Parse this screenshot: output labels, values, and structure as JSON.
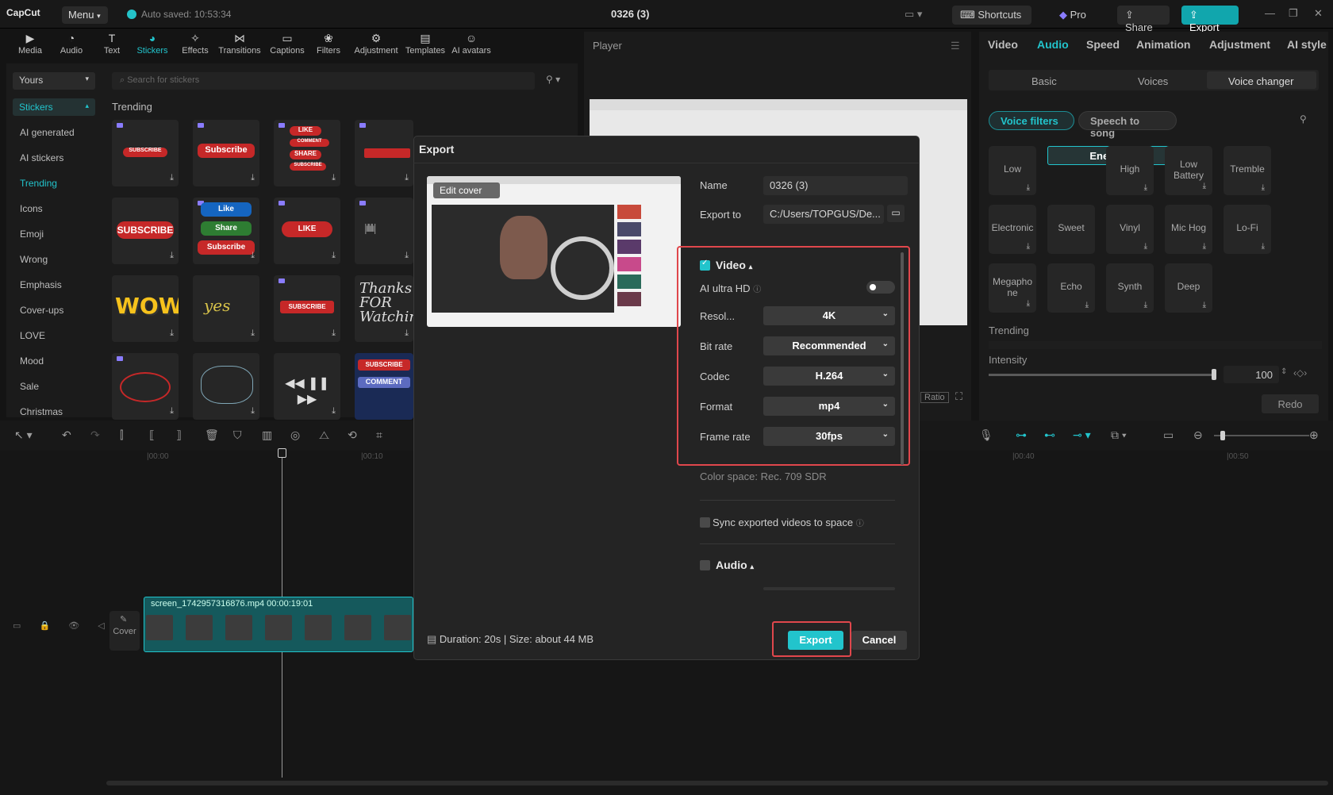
{
  "app": {
    "logo": "CapCut",
    "menu": "Menu",
    "autosaved": "Auto saved: 10:53:34",
    "title": "0326 (3)"
  },
  "topbar": {
    "shortcuts": "Shortcuts",
    "pro": "Pro",
    "share": "Share",
    "export": "Export"
  },
  "tools": [
    "Media",
    "Audio",
    "Text",
    "Stickers",
    "Effects",
    "Transitions",
    "Captions",
    "Filters",
    "Adjustment",
    "Templates",
    "AI avatars"
  ],
  "left": {
    "yours": "Yours",
    "search_placeholder": "Search for stickers",
    "categories": [
      "Stickers",
      "AI generated",
      "AI stickers",
      "Trending",
      "Icons",
      "Emoji",
      "Wrong",
      "Emphasis",
      "Cover-ups",
      "LOVE",
      "Mood",
      "Sale",
      "Christmas"
    ],
    "trending_heading": "Trending",
    "sticker_texts": [
      "SUBSCRIBE",
      "Subscribe",
      "LIKE",
      "COMMENT",
      "SHARE",
      "SUBSCRIBE",
      "Like",
      "Share",
      "Subscribe",
      "LIKE",
      "WOW!",
      "yes",
      "SUBSCRIBE",
      "Thanks FOR Watching",
      "SUBSCRIBE",
      "COMMENT"
    ]
  },
  "player": {
    "title": "Player",
    "ratio": "Ratio"
  },
  "right": {
    "tabs": [
      "Video",
      "Audio",
      "Speed",
      "Animation",
      "Adjustment",
      "AI style"
    ],
    "subtabs": [
      "Basic",
      "Voices",
      "Voice changer"
    ],
    "buttons": [
      "Voice filters",
      "Speech to song"
    ],
    "filters": [
      "Low",
      "Energetic",
      "High",
      "Low Battery",
      "Tremble",
      "Electronic",
      "Sweet",
      "Vinyl",
      "Mic Hog",
      "Lo-Fi",
      "Megaphone",
      "Echo",
      "Synth",
      "Deep"
    ],
    "trending": "Trending",
    "intensity_label": "Intensity",
    "intensity_value": "100",
    "intensity_level": 1.0,
    "redo": "Redo"
  },
  "timeline": {
    "ticks": [
      "|00:00",
      "|00:10",
      "|00:40",
      "|00:50"
    ],
    "cover": "Cover",
    "clip_label": "screen_1742957316876.mp4   00:00:19:01"
  },
  "export_dialog": {
    "title": "Export",
    "edit_cover": "Edit cover",
    "name_label": "Name",
    "name_value": "0326 (3)",
    "export_to_label": "Export to",
    "export_to_value": "C:/Users/TOPGUS/De...",
    "video_heading": "Video",
    "ai_ultra_hd": "AI ultra HD",
    "resolution_label": "Resol...",
    "resolution_value": "4K",
    "bitrate_label": "Bit rate",
    "bitrate_value": "Recommended",
    "codec_label": "Codec",
    "codec_value": "H.264",
    "format_label": "Format",
    "format_value": "mp4",
    "framerate_label": "Frame rate",
    "framerate_value": "30fps",
    "color_space": "Color space: Rec. 709 SDR",
    "sync_label": "Sync exported videos to space",
    "audio_heading": "Audio",
    "duration": "Duration: 20s | Size: about 44 MB",
    "export_button": "Export",
    "cancel_button": "Cancel"
  },
  "colors": {
    "accent": "#22c4cc",
    "highlight": "#e0474c"
  }
}
